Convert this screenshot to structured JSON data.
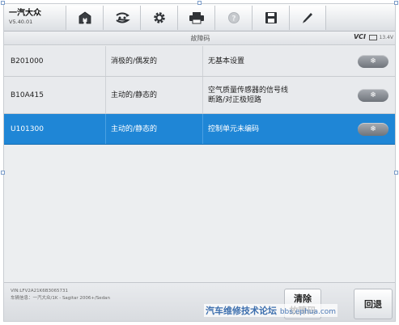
{
  "vehicle": {
    "name": "一汽大众",
    "version": "V5.40.01"
  },
  "toolbar": {
    "items": [
      {
        "icon": "home-icon"
      },
      {
        "icon": "vehicle-swap-icon"
      },
      {
        "icon": "gear-icon"
      },
      {
        "icon": "printer-icon"
      },
      {
        "icon": "help-icon"
      },
      {
        "icon": "save-icon"
      },
      {
        "icon": "pen-icon"
      }
    ]
  },
  "header": {
    "title": "故障码",
    "vci": "VCI",
    "voltage": "13.4V"
  },
  "table": {
    "rows": [
      {
        "code": "B201000",
        "status": "消极的/偶发的",
        "description": "无基本设置",
        "selected": false
      },
      {
        "code": "B10A415",
        "status": "主动的/静态的",
        "description": "空气质量传感器的信号线\n断路/对正极短路",
        "selected": false
      },
      {
        "code": "U101300",
        "status": "主动的/静态的",
        "description": "控制单元未编码",
        "selected": true
      }
    ],
    "freeze_icon": "snowflake-icon"
  },
  "footer": {
    "vin": "VIN:LFV2A21K6B3065731",
    "vehicle_info": "车辆信息：一汽大众/1K - Sagitar 2006+/Sedan",
    "clear_label": "清除\n故障码",
    "back_label": "回退"
  },
  "watermark": {
    "text": "汽车维修技术论坛",
    "url": "bbs.ephua.com"
  },
  "colors": {
    "selected_row": "#1f86d6",
    "background": "#eceef0"
  }
}
